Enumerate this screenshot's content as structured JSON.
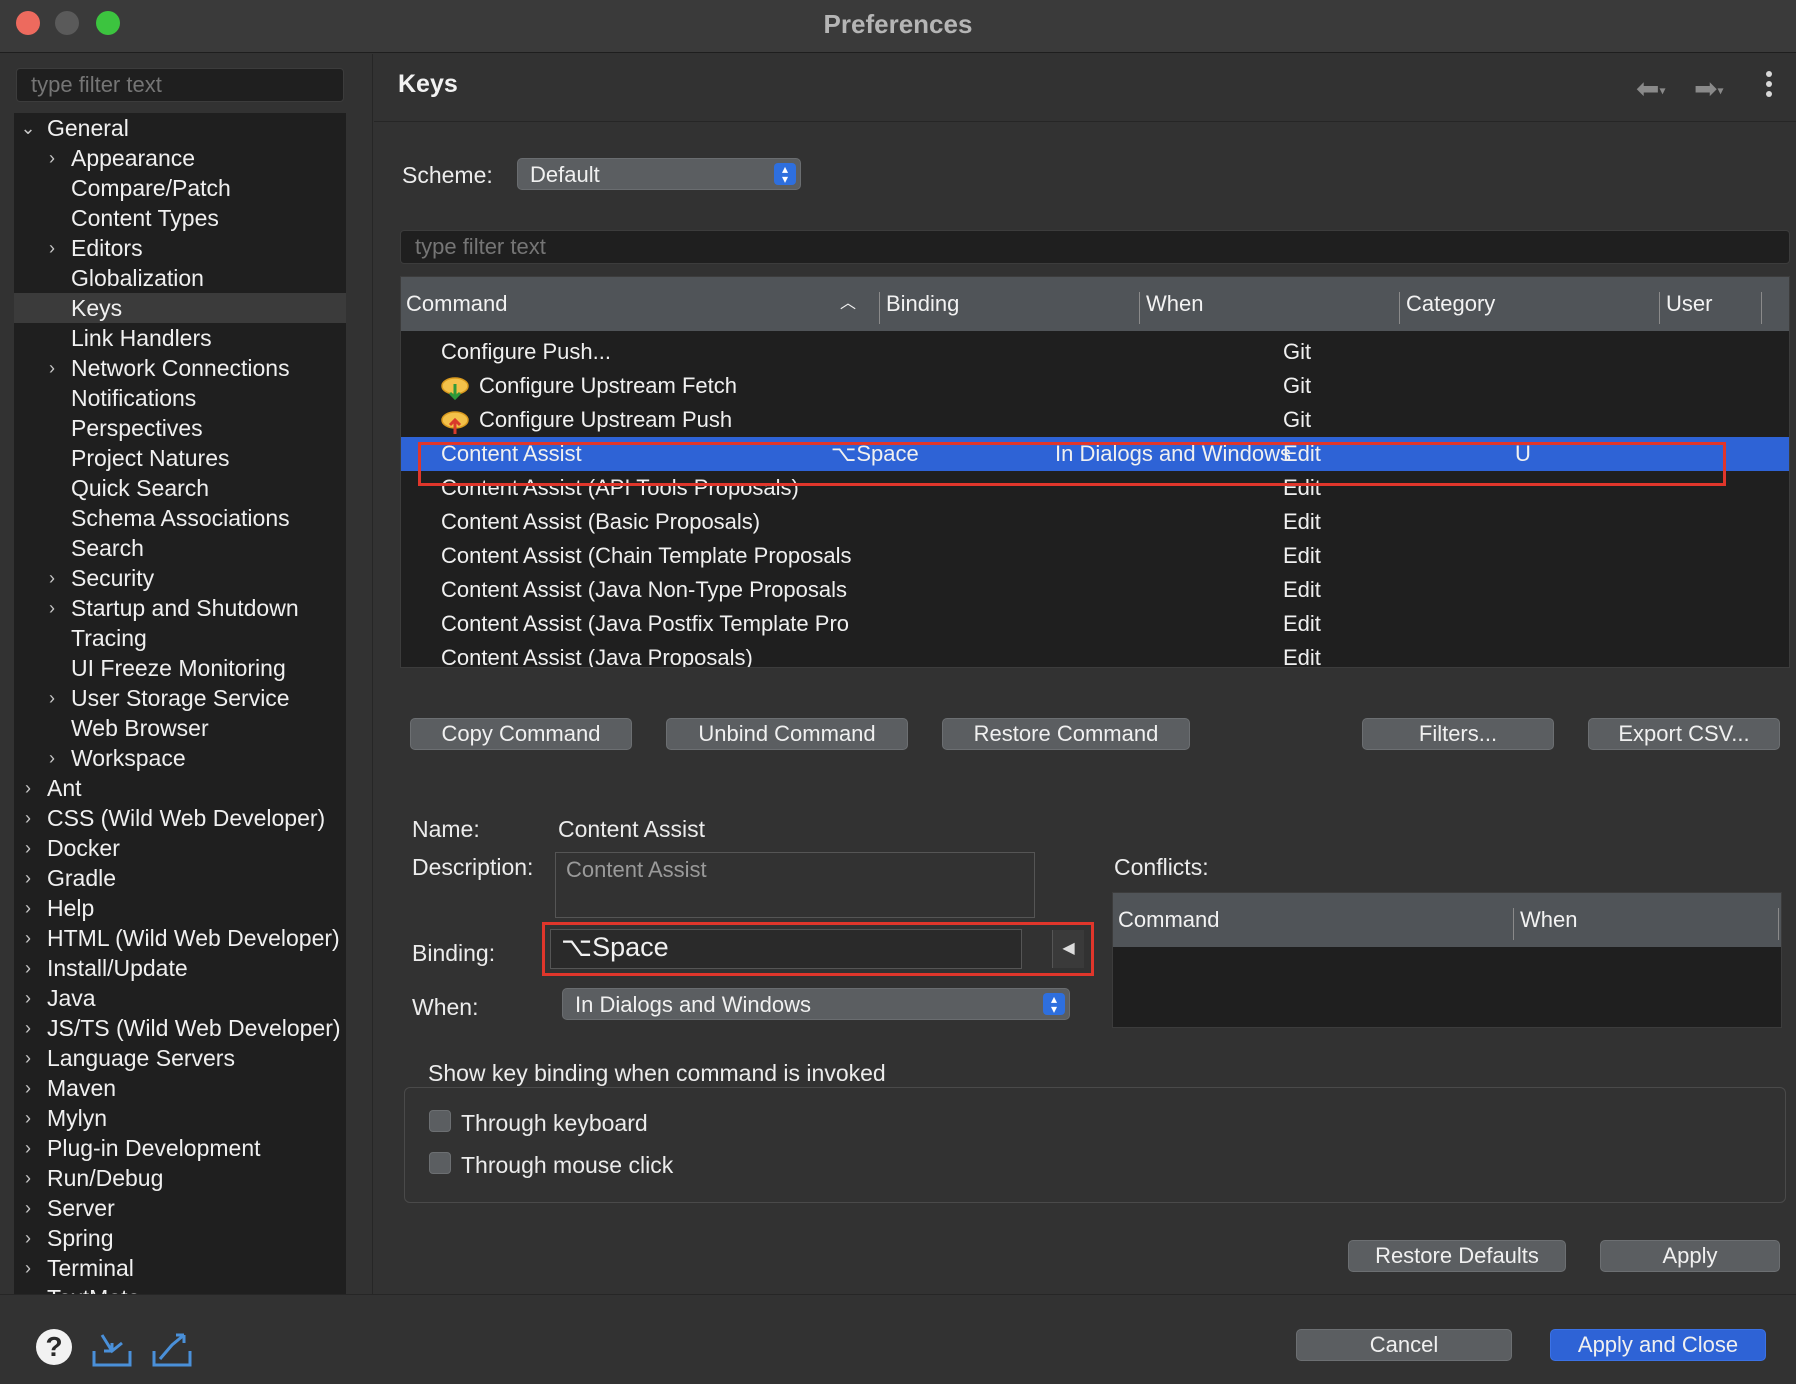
{
  "window": {
    "title": "Preferences"
  },
  "sidebar": {
    "filter_placeholder": "type filter text",
    "items": [
      {
        "label": "General",
        "level": 0,
        "expanded": true
      },
      {
        "label": "Appearance",
        "level": 1,
        "has_children": true
      },
      {
        "label": "Compare/Patch",
        "level": 1
      },
      {
        "label": "Content Types",
        "level": 1
      },
      {
        "label": "Editors",
        "level": 1,
        "has_children": true
      },
      {
        "label": "Globalization",
        "level": 1
      },
      {
        "label": "Keys",
        "level": 1,
        "selected": true
      },
      {
        "label": "Link Handlers",
        "level": 1
      },
      {
        "label": "Network Connections",
        "level": 1,
        "has_children": true
      },
      {
        "label": "Notifications",
        "level": 1
      },
      {
        "label": "Perspectives",
        "level": 1
      },
      {
        "label": "Project Natures",
        "level": 1
      },
      {
        "label": "Quick Search",
        "level": 1
      },
      {
        "label": "Schema Associations",
        "level": 1
      },
      {
        "label": "Search",
        "level": 1
      },
      {
        "label": "Security",
        "level": 1,
        "has_children": true
      },
      {
        "label": "Startup and Shutdown",
        "level": 1,
        "has_children": true
      },
      {
        "label": "Tracing",
        "level": 1
      },
      {
        "label": "UI Freeze Monitoring",
        "level": 1
      },
      {
        "label": "User Storage Service",
        "level": 1,
        "has_children": true
      },
      {
        "label": "Web Browser",
        "level": 1
      },
      {
        "label": "Workspace",
        "level": 1,
        "has_children": true
      },
      {
        "label": "Ant",
        "level": 0,
        "has_children": true
      },
      {
        "label": "CSS (Wild Web Developer)",
        "level": 0,
        "has_children": true
      },
      {
        "label": "Docker",
        "level": 0,
        "has_children": true
      },
      {
        "label": "Gradle",
        "level": 0,
        "has_children": true
      },
      {
        "label": "Help",
        "level": 0,
        "has_children": true
      },
      {
        "label": "HTML (Wild Web Developer)",
        "level": 0,
        "has_children": true
      },
      {
        "label": "Install/Update",
        "level": 0,
        "has_children": true
      },
      {
        "label": "Java",
        "level": 0,
        "has_children": true
      },
      {
        "label": "JS/TS (Wild Web Developer)",
        "level": 0,
        "has_children": true
      },
      {
        "label": "Language Servers",
        "level": 0,
        "has_children": true
      },
      {
        "label": "Maven",
        "level": 0,
        "has_children": true
      },
      {
        "label": "Mylyn",
        "level": 0,
        "has_children": true
      },
      {
        "label": "Plug-in Development",
        "level": 0,
        "has_children": true
      },
      {
        "label": "Run/Debug",
        "level": 0,
        "has_children": true
      },
      {
        "label": "Server",
        "level": 0,
        "has_children": true
      },
      {
        "label": "Spring",
        "level": 0,
        "has_children": true
      },
      {
        "label": "Terminal",
        "level": 0,
        "has_children": true
      },
      {
        "label": "TextMate",
        "level": 0,
        "has_children": true
      }
    ]
  },
  "page": {
    "title": "Keys",
    "scheme_label": "Scheme:",
    "scheme_value": "Default",
    "filter_placeholder": "type filter text"
  },
  "table": {
    "columns": [
      "Command",
      "Binding",
      "When",
      "Category",
      "User"
    ],
    "sort_indicator": "^",
    "rows": [
      {
        "command": "Configure Push...",
        "binding": "",
        "when": "",
        "category": "Git",
        "user": "",
        "icon": ""
      },
      {
        "command": "Configure Upstream Fetch",
        "binding": "",
        "when": "",
        "category": "Git",
        "user": "",
        "icon": "cloud-fetch-icon"
      },
      {
        "command": "Configure Upstream Push",
        "binding": "",
        "when": "",
        "category": "Git",
        "user": "",
        "icon": "cloud-push-icon"
      },
      {
        "command": "Content Assist",
        "binding": "⌥Space",
        "when": "In Dialogs and Windows",
        "category": "Edit",
        "user": "U",
        "selected": true
      },
      {
        "command": "Content Assist (API Tools Proposals)",
        "binding": "",
        "when": "",
        "category": "Edit",
        "user": ""
      },
      {
        "command": "Content Assist (Basic Proposals)",
        "binding": "",
        "when": "",
        "category": "Edit",
        "user": ""
      },
      {
        "command": "Content Assist (Chain Template Proposals",
        "binding": "",
        "when": "",
        "category": "Edit",
        "user": ""
      },
      {
        "command": "Content Assist (Java Non-Type Proposals",
        "binding": "",
        "when": "",
        "category": "Edit",
        "user": ""
      },
      {
        "command": "Content Assist (Java Postfix Template Pro",
        "binding": "",
        "when": "",
        "category": "Edit",
        "user": ""
      },
      {
        "command": "Content Assist (Java Proposals)",
        "binding": "",
        "when": "",
        "category": "Edit",
        "user": ""
      }
    ]
  },
  "actions": {
    "copy": "Copy Command",
    "unbind": "Unbind Command",
    "restore": "Restore Command",
    "filters": "Filters...",
    "export": "Export CSV..."
  },
  "details": {
    "name_label": "Name:",
    "name_value": "Content Assist",
    "description_label": "Description:",
    "description_value": "Content Assist",
    "binding_label": "Binding:",
    "binding_value": "⌥Space",
    "when_label": "When:",
    "when_value": "In Dialogs and Windows",
    "conflicts_label": "Conflicts:",
    "conflicts_columns": [
      "Command",
      "When"
    ]
  },
  "show_binding": {
    "title": "Show key binding when command is invoked",
    "keyboard": "Through keyboard",
    "mouse": "Through mouse click"
  },
  "footer": {
    "restore_defaults": "Restore Defaults",
    "apply": "Apply",
    "cancel": "Cancel",
    "apply_close": "Apply and Close"
  },
  "colors": {
    "selection": "#2e63d6",
    "highlight_box": "#e0362b",
    "primary_button": "#2e63d6"
  }
}
